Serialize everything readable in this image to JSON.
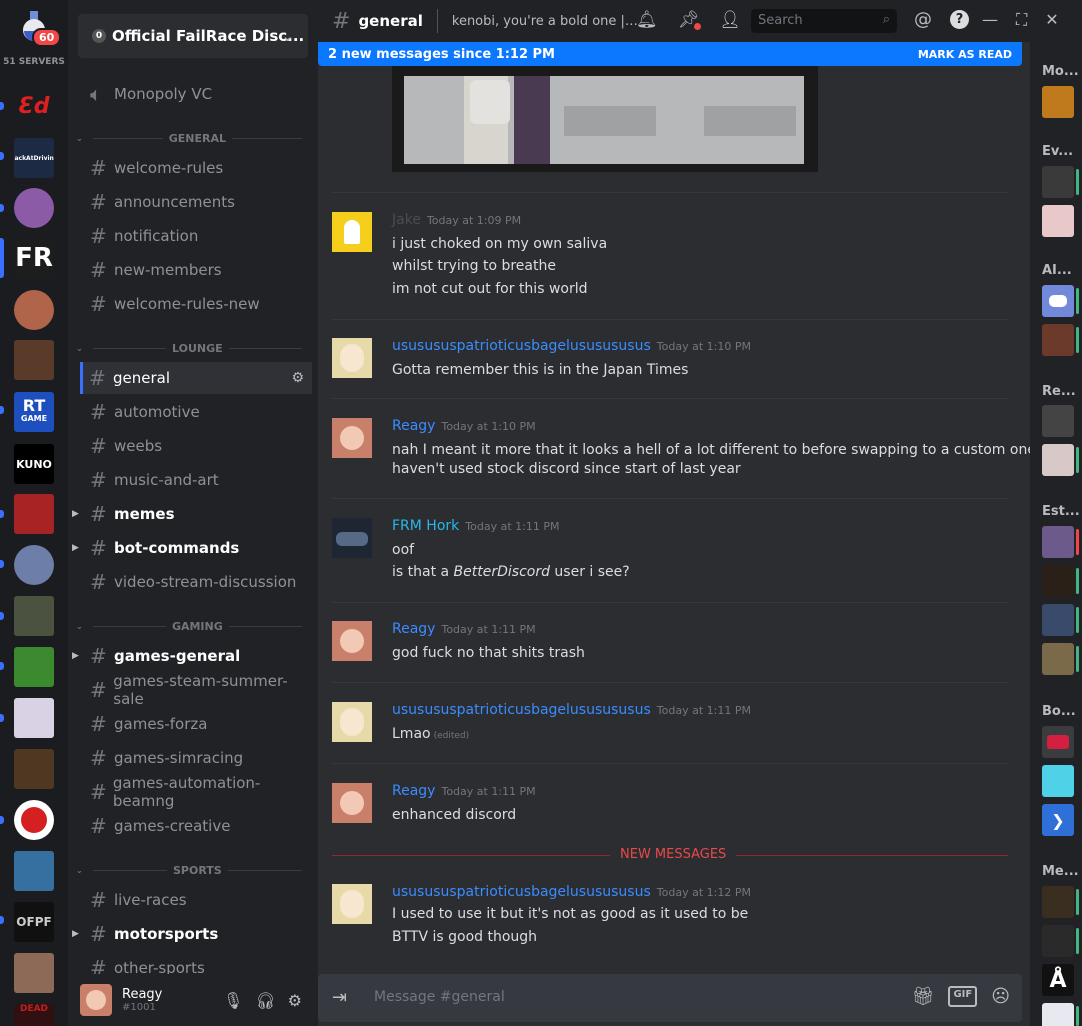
{
  "app": {
    "badge_count": "60",
    "servers_label": "51 SERVERS"
  },
  "guild": {
    "name": "Official FailRace Disc...",
    "icon_letter": "0"
  },
  "channels": {
    "voice": "Monopoly VC",
    "categories": [
      {
        "label": "GENERAL"
      },
      {
        "label": "LOUNGE"
      },
      {
        "label": "GAMING"
      },
      {
        "label": "SPORTS"
      }
    ],
    "items": [
      "welcome-rules",
      "announcements",
      "notification",
      "new-members",
      "welcome-rules-new",
      "general",
      "automotive",
      "weebs",
      "music-and-art",
      "memes",
      "bot-commands",
      "video-stream-discussion",
      "games-general",
      "games-steam-summer-sale",
      "games-forza",
      "games-simracing",
      "games-automation-beamng",
      "games-creative",
      "live-races",
      "motorsports",
      "other-sports"
    ]
  },
  "user": {
    "name": "Reagy",
    "tag": "#1001"
  },
  "topbar": {
    "channel": "general",
    "topic": "kenobi, you're a bold one | Ge...",
    "search_placeholder": "Search"
  },
  "banner": {
    "text": "2 new messages since 1:12 PM",
    "mark_read": "MARK AS READ"
  },
  "messages": [
    {
      "author": "Jake",
      "time": "Today at 1:09 PM",
      "lines": [
        "i just choked on my own saliva",
        "whilst trying to breathe",
        "im not cut out for this world"
      ]
    },
    {
      "author": "ususususpatrioticusbagelususususus",
      "time": "Today at 1:10 PM",
      "lines": [
        "Gotta remember this is in the Japan Times"
      ]
    },
    {
      "author": "Reagy",
      "time": "Today at 1:10 PM",
      "lines": [
        "nah I meant it more that it looks a hell of a lot different to before swapping to a custom one,",
        "haven't used stock discord since start of last year"
      ]
    },
    {
      "author": "FRM Hork",
      "time": "Today at 1:11 PM",
      "lines": [
        "oof"
      ],
      "line2_pre": "is that a ",
      "line2_em": "BetterDiscord",
      "line2_post": " user i see?"
    },
    {
      "author": "Reagy",
      "time": "Today at 1:11 PM",
      "lines": [
        "god fuck no that shits trash"
      ]
    },
    {
      "author": "ususususpatrioticusbagelususususus",
      "time": "Today at 1:11 PM",
      "lines": [
        "Lmao"
      ],
      "edited": "(edited)"
    },
    {
      "author": "Reagy",
      "time": "Today at 1:11 PM",
      "lines": [
        "enhanced discord"
      ]
    },
    {
      "author": "ususususpatrioticusbagelususususus",
      "time": "Today at 1:12 PM",
      "lines": [
        "I used to use it but it's not as good as it used to be",
        "BTTV is good though"
      ]
    }
  ],
  "new_messages_label": "NEW MESSAGES",
  "composer": {
    "placeholder": "Message #general",
    "gif": "GIF"
  },
  "members": {
    "groups": [
      "Mo...",
      "Ev...",
      "AI...",
      "Re...",
      "Est...",
      "Bo...",
      "Me..."
    ]
  },
  "servers": {
    "fr": "FR",
    "rt": "RT",
    "rt_sub": "GAME",
    "kuno": "KUNO",
    "ofpf": "OFPF",
    "dead": "DEAD"
  },
  "colors": {
    "accent": "#0c78ff",
    "author_blue": "#3b8cff",
    "author_cyan": "#26b8e8",
    "new_red": "#e84a4a"
  }
}
